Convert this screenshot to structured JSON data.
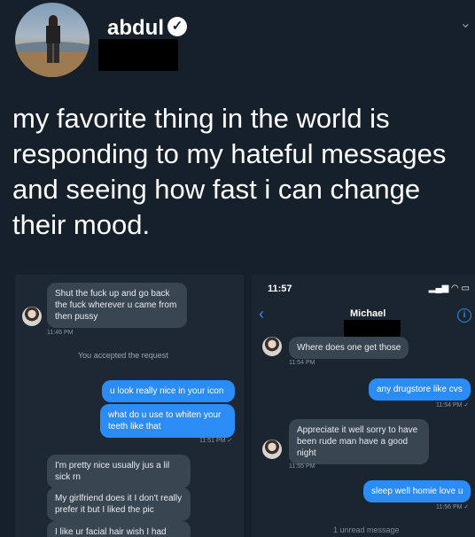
{
  "profile": {
    "username": "abdul",
    "verified_icon": "verified-check-icon",
    "tweet_text": "my favorite thing in the world is responding to my hateful messages and seeing how fast i can change their mood."
  },
  "left_chat": {
    "messages": [
      {
        "dir": "in",
        "text": "Shut the fuck up and go back the fuck wherever u came from then pussy"
      },
      {
        "dir": "out",
        "text": "u look really nice in your icon"
      },
      {
        "dir": "out",
        "text": "what do u use to whiten your teeth like that"
      },
      {
        "dir": "in",
        "text": "I'm pretty nice usually jus a lil sick rn"
      },
      {
        "dir": "in",
        "text": "My girlfriend does it I don't really prefer it but I liked the pic"
      },
      {
        "dir": "in",
        "text": "I like ur facial hair wish I had"
      }
    ],
    "time1": "11:46 PM",
    "system_text": "You accepted the request",
    "time2": "11:51 PM ✓"
  },
  "right_chat": {
    "status_time": "11:57",
    "contact_name": "Michael",
    "messages": [
      {
        "dir": "in",
        "text": "Where does one get those",
        "time": "11:54 PM"
      },
      {
        "dir": "out",
        "text": "any drugstore like cvs",
        "time": "11:54 PM ✓"
      },
      {
        "dir": "in",
        "text": "Appreciate it well sorry to have been rude man have a good night",
        "time": "11:55 PM"
      },
      {
        "dir": "out",
        "text": "sleep well homie love u",
        "time": "11:56 PM ✓"
      }
    ],
    "unread": "1 unread message"
  }
}
